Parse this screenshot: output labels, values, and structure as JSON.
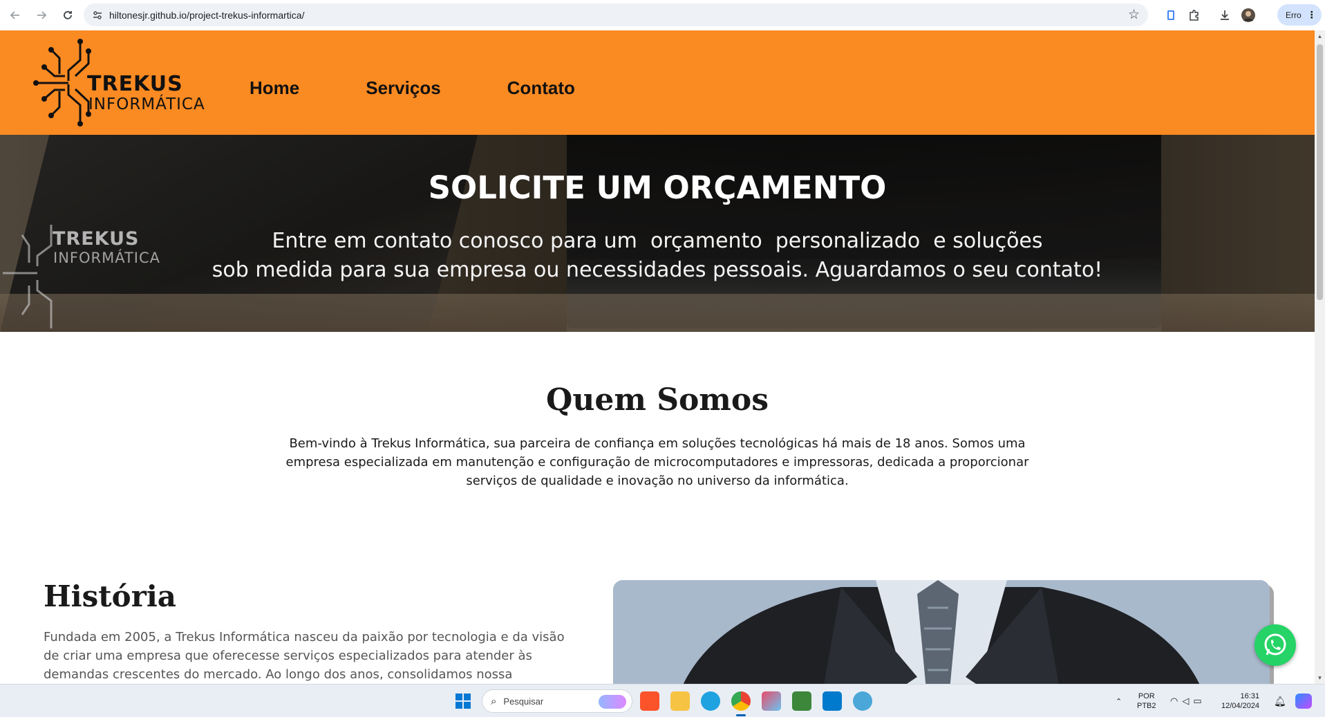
{
  "browser": {
    "url": "hiltonesjr.github.io/project-trekus-informartica/",
    "profile_label": "Erro",
    "icons": [
      "back-arrow-icon",
      "forward-arrow-icon",
      "reload-icon",
      "site-info-icon",
      "star-icon",
      "extension-icon",
      "puzzle-icon",
      "download-icon",
      "avatar",
      "kebab-menu-icon"
    ]
  },
  "header": {
    "logo_line1": "TREKUS",
    "logo_line2": "INFORMÁTICA",
    "nav": {
      "home": "Home",
      "services": "Serviços",
      "contact": "Contato"
    },
    "background_color": "#fa8a22"
  },
  "hero": {
    "title": "SOLICITE UM ORÇAMENTO",
    "subtitle_line1": "Entre em contato conosco para um  orçamento  personalizado  e soluções",
    "subtitle_line2": "sob medida para sua empresa ou necessidades pessoais. Aguardamos o seu contato!",
    "watermark_line1": "TREKUS",
    "watermark_line2": "INFORMÁTICA"
  },
  "about": {
    "title": "Quem Somos",
    "text": "Bem-vindo à Trekus Informática, sua parceira de confiança em soluções tecnológicas há mais de 18 anos. Somos uma empresa especializada em manutenção e configuração de microcomputadores e impressoras, dedicada a proporcionar serviços de qualidade e inovação no universo da informática."
  },
  "history": {
    "title": "História",
    "text": "Fundada em 2005, a Trekus Informática nasceu da paixão por tecnologia e da visão de criar uma empresa que oferecesse serviços especializados para atender às demandas crescentes do mercado. Ao longo dos anos, consolidamos nossa"
  },
  "whatsapp": {
    "icon": "whatsapp-icon",
    "color": "#25d366"
  },
  "taskbar": {
    "search_placeholder": "Pesquisar",
    "lang_line1": "POR",
    "lang_line2": "PTB2",
    "time": "16:31",
    "date": "12/04/2024",
    "apps": [
      "brave-icon",
      "file-explorer-icon",
      "edge-icon",
      "chrome-icon",
      "tasks-app-icon",
      "nodejs-icon",
      "vscode-icon",
      "globe-app-icon"
    ]
  }
}
